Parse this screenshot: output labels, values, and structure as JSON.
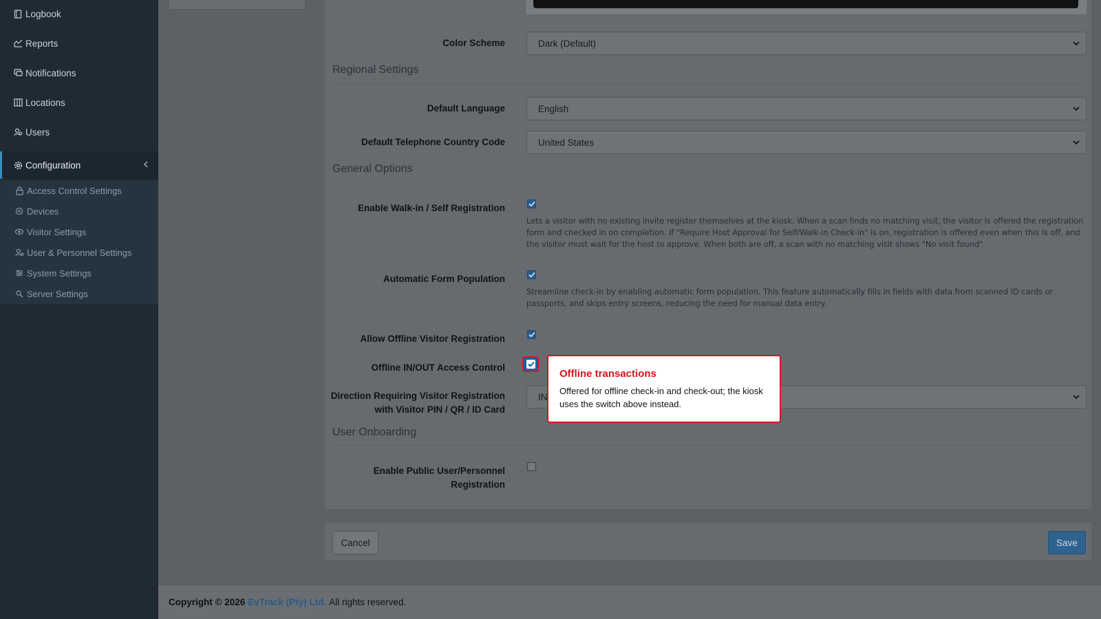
{
  "sidebar": {
    "items": [
      {
        "label": "Logbook",
        "icon": "book-icon"
      },
      {
        "label": "Reports",
        "icon": "chart-icon"
      },
      {
        "label": "Notifications",
        "icon": "chat-icon"
      },
      {
        "label": "Locations",
        "icon": "map-icon"
      },
      {
        "label": "Users",
        "icon": "users-icon"
      },
      {
        "label": "Configuration",
        "icon": "gear-icon"
      }
    ],
    "sub_items": [
      {
        "label": "Access Control Settings",
        "icon": "lock-icon"
      },
      {
        "label": "Devices",
        "icon": "device-icon"
      },
      {
        "label": "Visitor Settings",
        "icon": "eye-icon"
      },
      {
        "label": "User & Personnel Settings",
        "icon": "user-settings-icon"
      },
      {
        "label": "System Settings",
        "icon": "sliders-icon"
      },
      {
        "label": "Server Settings",
        "icon": "server-icon"
      }
    ]
  },
  "form": {
    "color_scheme": {
      "label": "Color Scheme",
      "value": "Dark (Default)"
    },
    "regional_title": "Regional Settings",
    "default_language": {
      "label": "Default Language",
      "value": "English"
    },
    "telephone_code": {
      "label": "Default Telephone Country Code",
      "value": "United States"
    },
    "general_title": "General Options",
    "walkin": {
      "label": "Enable Walk-in / Self Registration",
      "checked": true,
      "help": "Lets a visitor with no existing invite register themselves at the kiosk. When a scan finds no matching visit, the visitor is offered the registration form and checked in on completion. If \"Require Host Approval for Self/Walk-in Check-in\" is on, registration is offered even when this is off, and the visitor must wait for the host to approve. When both are off, a scan with no matching visit shows \"No visit found\"."
    },
    "auto_form": {
      "label": "Automatic Form Population",
      "checked": true,
      "help": "Streamline check-in by enabling automatic form population. This feature automatically fills in fields with data from scanned ID cards or passports, and skips entry screens, reducing the need for manual data entry."
    },
    "offline_reg": {
      "label": "Allow Offline Visitor Registration",
      "checked": true
    },
    "offline_inout": {
      "label": "Offline IN/OUT Access Control",
      "checked": true
    },
    "direction": {
      "label_line1": "Direction Requiring Visitor Registration",
      "label_line2": "with Visitor PIN / QR / ID Card",
      "value": "IN"
    },
    "onboarding_title": "User Onboarding",
    "public_reg": {
      "label_line1": "Enable Public User/Personnel",
      "label_line2": "Registration",
      "checked": false
    }
  },
  "tooltip": {
    "title": "Offline transactions",
    "body": "Offered for offline check-in and check-out; the kiosk uses the switch above instead."
  },
  "buttons": {
    "cancel": "Cancel",
    "save": "Save"
  },
  "footer": {
    "prefix": "Copyright © 2026",
    "company": "EvTrack (Pty) Ltd.",
    "suffix": "All rights reserved."
  },
  "colors": {
    "accent": "#3c8dbc",
    "highlight": "#d9121c",
    "sidebar_bg": "#1f2a33"
  }
}
